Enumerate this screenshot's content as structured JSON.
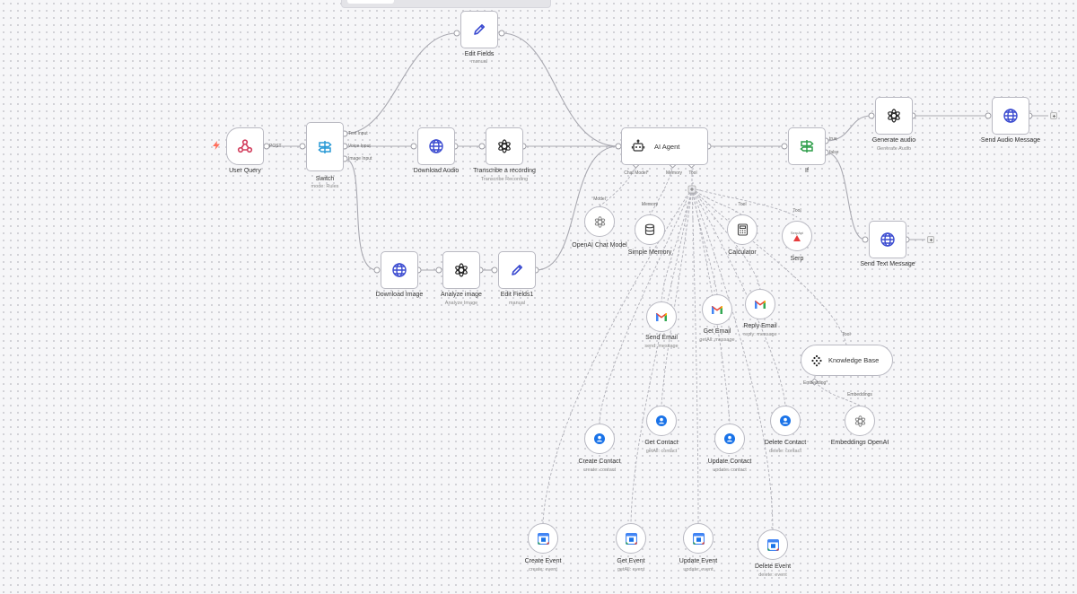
{
  "nodes": {
    "user_query": {
      "label": "User Query"
    },
    "switch": {
      "label": "Switch",
      "sub": "mode: Rules",
      "outputs": [
        "Text Input",
        "Voice Input",
        "Image Input"
      ]
    },
    "edit_fields": {
      "label": "Edit Fields",
      "sub": "manual"
    },
    "download_audio": {
      "label": "Download Audio"
    },
    "transcribe": {
      "label": "Transcribe a recording",
      "sub": "Transcribe Recording"
    },
    "download_image": {
      "label": "Download Image"
    },
    "analyze_image": {
      "label": "Analyze image",
      "sub": "Analyze Image"
    },
    "edit_fields1": {
      "label": "Edit Fields1",
      "sub": "manual"
    },
    "ai_agent": {
      "label": "AI Agent",
      "ports": {
        "chat_model": "Chat Model*",
        "memory": "Memory",
        "tool": "Tool"
      }
    },
    "if": {
      "label": "If",
      "outputs": [
        "true",
        "false"
      ]
    },
    "generate_audio": {
      "label": "Generate audio",
      "sub": "Generate Audio"
    },
    "send_audio": {
      "label": "Send Audio Message"
    },
    "send_text": {
      "label": "Send Text Message"
    },
    "openai_chat_model": {
      "label": "OpenAI Chat Model",
      "port": "Model"
    },
    "simple_memory": {
      "label": "Simple Memory",
      "port": "Memory"
    },
    "calculator": {
      "label": "Calculator",
      "port": "Tool"
    },
    "serp": {
      "label": "Serp",
      "port": "Tool",
      "badge": "SerpApi"
    },
    "send_email": {
      "label": "Send Email",
      "sub": "send: message"
    },
    "get_email": {
      "label": "Get Email",
      "sub": "getAll: message"
    },
    "reply_email": {
      "label": "Reply Email",
      "sub": "reply: message"
    },
    "knowledge_base": {
      "label": "Knowledge Base",
      "port": "Tool",
      "embedding_port": "Embedding*"
    },
    "embeddings_openai": {
      "label": "Embeddings OpenAI",
      "port": "Embeddings"
    },
    "create_contact": {
      "label": "Create Contact",
      "sub": "create: contact"
    },
    "get_contact": {
      "label": "Get Contact",
      "sub": "getAll: contact"
    },
    "update_contact": {
      "label": "Update Contact",
      "sub": "update: contact"
    },
    "delete_contact": {
      "label": "Delete Contact",
      "sub": "delete: contact"
    },
    "create_event": {
      "label": "Create Event",
      "sub": "create: event"
    },
    "get_event": {
      "label": "Get Event",
      "sub": "getAll: event"
    },
    "update_event": {
      "label": "Update Event",
      "sub": "update: event"
    },
    "delete_event": {
      "label": "Delete Event",
      "sub": "delete: event"
    }
  },
  "edges": {
    "post_label": "POST"
  },
  "icons": {
    "webhook": "webhook-icon",
    "switch": "signpost-icon",
    "pencil": "pencil-icon",
    "globe": "globe-icon",
    "openai": "openai-icon",
    "robot": "robot-icon",
    "database": "database-icon",
    "calculator": "calculator-icon",
    "gmail": "gmail-icon",
    "contacts": "contacts-icon",
    "calendar": "calendar-icon",
    "pinecone": "pinecone-icon"
  },
  "colors": {
    "accent_blue": "#3b4bd0",
    "webhook": "#d23d5c",
    "signpost": "#2a9ad6",
    "if_green": "#2e9e4a",
    "gmail_red": "#ea4335",
    "contacts_blue": "#1a73e8",
    "trigger": "#ff6d5a",
    "edge": "#a9a9b1"
  }
}
